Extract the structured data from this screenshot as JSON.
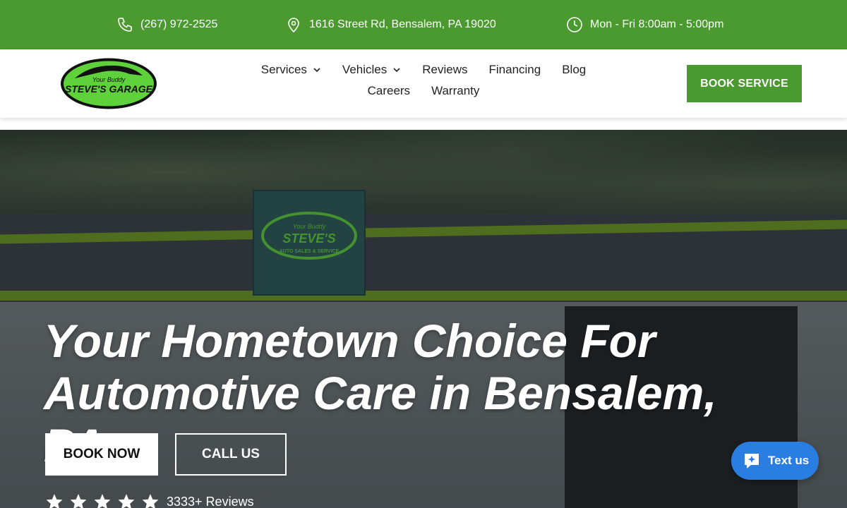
{
  "topbar": {
    "phone": "(267) 972-2525",
    "address": "1616 Street Rd, Bensalem, PA 19020",
    "hours": "Mon - Fri 8:00am - 5:00pm"
  },
  "logo": {
    "line1": "Your Buddy",
    "line2": "STEVE'S GARAGE"
  },
  "nav": {
    "items": [
      {
        "label": "Services",
        "dropdown": true
      },
      {
        "label": "Vehicles",
        "dropdown": true
      },
      {
        "label": "Reviews",
        "dropdown": false
      },
      {
        "label": "Financing",
        "dropdown": false
      },
      {
        "label": "Blog",
        "dropdown": false
      },
      {
        "label": "Careers",
        "dropdown": false
      },
      {
        "label": "Warranty",
        "dropdown": false
      }
    ],
    "cta": "BOOK SERVICE"
  },
  "hero": {
    "title_line1": "Your Hometown Choice For",
    "title_line2": "Automotive Care in Bensalem, PA",
    "book_button": "BOOK NOW",
    "call_button": "CALL US",
    "stars": 5,
    "reviews_label": "3333+ Reviews",
    "banner_line1": "Your Buddy",
    "banner_line2": "STEVE'S",
    "banner_line3": "AUTO SALES & SERVICE"
  },
  "chat_widget": {
    "label": "Text us"
  },
  "colors": {
    "brand_green": "#4a9a2f",
    "chat_blue": "#2a7de1"
  }
}
